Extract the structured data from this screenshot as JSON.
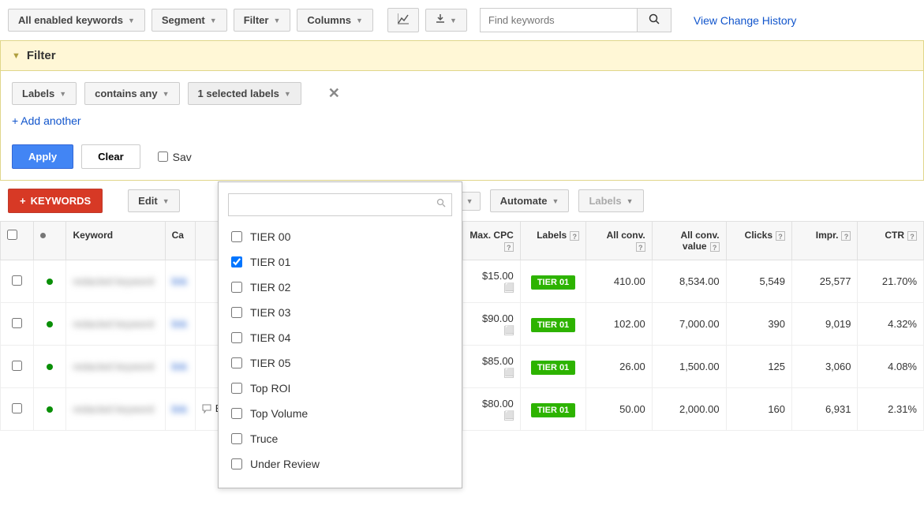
{
  "toolbar": {
    "keywords_scope": "All enabled keywords",
    "segment": "Segment",
    "filter": "Filter",
    "columns": "Columns",
    "find_placeholder": "Find keywords",
    "history_link": "View Change History"
  },
  "filter": {
    "title": "Filter",
    "field": "Labels",
    "operator": "contains any",
    "selected_summary": "1 selected labels",
    "add_another": "+ Add another",
    "apply": "Apply",
    "clear": "Clear",
    "save_filter": "Sav"
  },
  "label_options": [
    {
      "label": "TIER 00",
      "checked": false
    },
    {
      "label": "TIER 01",
      "checked": true
    },
    {
      "label": "TIER 02",
      "checked": false
    },
    {
      "label": "TIER 03",
      "checked": false
    },
    {
      "label": "TIER 04",
      "checked": false
    },
    {
      "label": "TIER 05",
      "checked": false
    },
    {
      "label": "Top ROI",
      "checked": false
    },
    {
      "label": "Top Volume",
      "checked": false
    },
    {
      "label": "Truce",
      "checked": false
    },
    {
      "label": "Under Review",
      "checked": false
    }
  ],
  "actions": {
    "add_keywords": "KEYWORDS",
    "edit": "Edit",
    "automate": "Automate",
    "labels": "Labels"
  },
  "columns": {
    "keyword": "Keyword",
    "campaign": "Ca",
    "max_cpc": "Max. CPC",
    "labels": "Labels",
    "all_conv": "All conv.",
    "all_conv_value": "All conv. value",
    "clicks": "Clicks",
    "impr": "Impr.",
    "ctr": "CTR"
  },
  "rows": [
    {
      "status": "Eligible",
      "max_cpc": "$15.00",
      "label": "TIER 01",
      "all_conv": "410.00",
      "all_conv_value": "8,534.00",
      "clicks": "5,549",
      "impr": "25,577",
      "ctr": "21.70%"
    },
    {
      "status": "Eligible",
      "max_cpc": "$90.00",
      "label": "TIER 01",
      "all_conv": "102.00",
      "all_conv_value": "7,000.00",
      "clicks": "390",
      "impr": "9,019",
      "ctr": "4.32%"
    },
    {
      "status": "Eligible",
      "max_cpc": "$85.00",
      "label": "TIER 01",
      "all_conv": "26.00",
      "all_conv_value": "1,500.00",
      "clicks": "125",
      "impr": "3,060",
      "ctr": "4.08%"
    },
    {
      "status": "Eligible",
      "max_cpc": "$80.00",
      "label": "TIER 01",
      "all_conv": "50.00",
      "all_conv_value": "2,000.00",
      "clicks": "160",
      "impr": "6,931",
      "ctr": "2.31%"
    }
  ]
}
